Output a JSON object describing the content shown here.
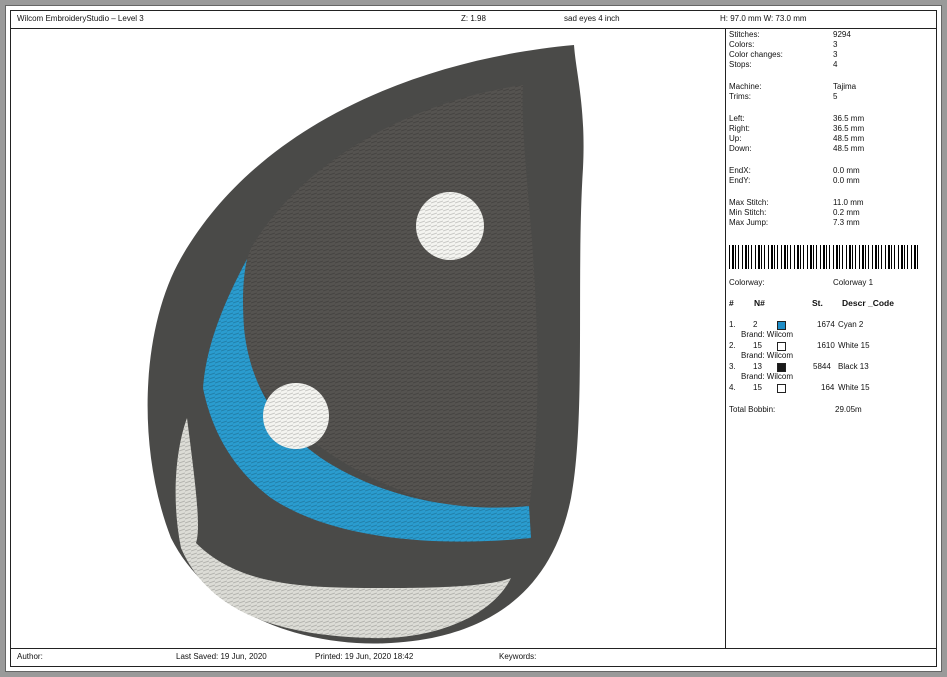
{
  "header": {
    "app_title": "Wilcom EmbroideryStudio – Level 3",
    "zoom": "Z: 1.98",
    "design_name": "sad eyes 4 inch",
    "size": "H: 97.0 mm   W: 73.0 mm"
  },
  "stats": [
    {
      "label": "Stitches:",
      "value": "9294"
    },
    {
      "label": "Colors:",
      "value": "3"
    },
    {
      "label": "Color changes:",
      "value": "3"
    },
    {
      "label": "Stops:",
      "value": "4"
    },
    {
      "label": "Machine:",
      "value": "Tajima"
    },
    {
      "label": "Trims:",
      "value": "5"
    },
    {
      "label": "Left:",
      "value": "36.5 mm"
    },
    {
      "label": "Right:",
      "value": "36.5 mm"
    },
    {
      "label": "Up:",
      "value": "48.5 mm"
    },
    {
      "label": "Down:",
      "value": "48.5 mm"
    },
    {
      "label": "EndX:",
      "value": "0.0 mm"
    },
    {
      "label": "EndY:",
      "value": "0.0 mm"
    },
    {
      "label": "Max Stitch:",
      "value": "11.0 mm"
    },
    {
      "label": "Min Stitch:",
      "value": "0.2 mm"
    },
    {
      "label": "Max Jump:",
      "value": "7.3 mm"
    }
  ],
  "colorway": {
    "label": "Colorway:",
    "value": "Colorway 1"
  },
  "color_table": {
    "headers": {
      "idx": "#",
      "num": "N#",
      "st": "St.",
      "descr": "Descr _Code"
    },
    "rows": [
      {
        "idx": "1.",
        "num": "2",
        "color": "#1e8ec8",
        "st": "1674",
        "descr": "Cyan 2",
        "brand": "Brand: Wilcom"
      },
      {
        "idx": "2.",
        "num": "15",
        "color": "#ffffff",
        "st": "1610",
        "descr": "White 15",
        "brand": "Brand: Wilcom"
      },
      {
        "idx": "3.",
        "num": "13",
        "color": "#1a1a1a",
        "st": "5844",
        "descr": "Black 13",
        "brand": "Brand: Wilcom"
      },
      {
        "idx": "4.",
        "num": "15",
        "color": "#ffffff",
        "st": "164",
        "descr": "White 15",
        "brand": "Brand: Wilcom"
      }
    ],
    "total_bobbin_label": "Total Bobbin:",
    "total_bobbin_value": "29.05m"
  },
  "footer": {
    "author": "Author:",
    "last_saved": "Last Saved: 19 Jun, 2020",
    "printed": "Printed: 19 Jun, 2020 18:42",
    "keywords": "Keywords:"
  },
  "design_colors": {
    "outline": "#4a4a48",
    "pupil": "#555350",
    "iris": "#2a9ccf",
    "lower": "#dcdcd6",
    "highlight": "#f4f4f0"
  }
}
